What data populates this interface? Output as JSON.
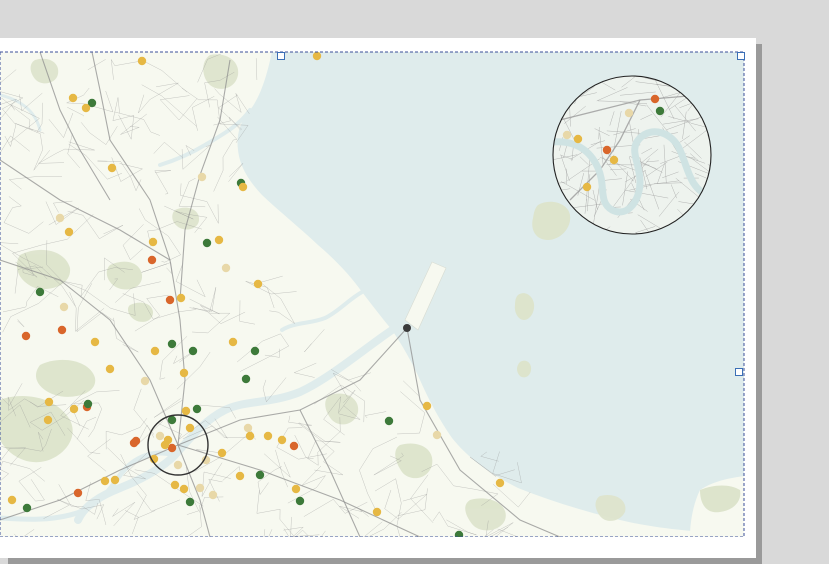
{
  "colors": {
    "background": "#d9d9d9",
    "page": "#ffffff",
    "land": "#f7f9f0",
    "water": "#dfecec",
    "parks": "#dde4cc",
    "roads": "#8f8f8f",
    "selection": "#3b6fb6",
    "marker_yellow": "#e6b844",
    "marker_orange": "#d9662b",
    "marker_green": "#3d7a3a",
    "marker_beige": "#e8d8a8",
    "marker_dark": "#3a3a3a"
  },
  "map": {
    "markers": [
      {
        "kind": "yellow"
      },
      {
        "kind": "yellow"
      },
      {
        "kind": "yellow"
      },
      {
        "kind": "green"
      },
      {
        "kind": "yellow"
      },
      {
        "kind": "yellow"
      },
      {
        "kind": "beige"
      },
      {
        "kind": "green"
      },
      {
        "kind": "yellow"
      },
      {
        "kind": "beige"
      },
      {
        "kind": "yellow"
      },
      {
        "kind": "yellow"
      },
      {
        "kind": "green"
      },
      {
        "kind": "yellow"
      },
      {
        "kind": "orange"
      },
      {
        "kind": "beige"
      },
      {
        "kind": "yellow"
      },
      {
        "kind": "green"
      },
      {
        "kind": "beige"
      },
      {
        "kind": "orange"
      },
      {
        "kind": "yellow"
      },
      {
        "kind": "orange"
      },
      {
        "kind": "yellow"
      },
      {
        "kind": "yellow"
      },
      {
        "kind": "green"
      },
      {
        "kind": "green"
      },
      {
        "kind": "yellow"
      },
      {
        "kind": "green"
      },
      {
        "kind": "yellow"
      },
      {
        "kind": "yellow"
      },
      {
        "kind": "beige"
      },
      {
        "kind": "green"
      },
      {
        "kind": "yellow"
      },
      {
        "kind": "yellow"
      },
      {
        "kind": "orange"
      },
      {
        "kind": "yellow"
      },
      {
        "kind": "green"
      },
      {
        "kind": "green"
      },
      {
        "kind": "yellow"
      },
      {
        "kind": "beige"
      },
      {
        "kind": "yellow"
      },
      {
        "kind": "yellow"
      },
      {
        "kind": "orange"
      },
      {
        "kind": "dark"
      },
      {
        "kind": "yellow"
      },
      {
        "kind": "beige"
      },
      {
        "kind": "yellow"
      },
      {
        "kind": "green"
      },
      {
        "kind": "yellow"
      },
      {
        "kind": "green"
      },
      {
        "kind": "yellow"
      },
      {
        "kind": "orange"
      },
      {
        "kind": "yellow"
      },
      {
        "kind": "yellow"
      },
      {
        "kind": "beige"
      },
      {
        "kind": "green"
      },
      {
        "kind": "yellow"
      },
      {
        "kind": "orange"
      },
      {
        "kind": "yellow"
      },
      {
        "kind": "beige"
      },
      {
        "kind": "yellow"
      },
      {
        "kind": "green"
      },
      {
        "kind": "yellow"
      },
      {
        "kind": "green"
      },
      {
        "kind": "yellow"
      },
      {
        "kind": "beige"
      },
      {
        "kind": "yellow"
      },
      {
        "kind": "orange"
      },
      {
        "kind": "yellow"
      },
      {
        "kind": "beige"
      },
      {
        "kind": "yellow"
      },
      {
        "kind": "green"
      },
      {
        "kind": "orange"
      },
      {
        "kind": "yellow"
      },
      {
        "kind": "green"
      },
      {
        "kind": "beige"
      },
      {
        "kind": "yellow"
      },
      {
        "kind": "orange"
      }
    ],
    "inset_markers": [
      {
        "kind": "orange"
      },
      {
        "kind": "green"
      },
      {
        "kind": "beige"
      },
      {
        "kind": "beige"
      },
      {
        "kind": "yellow"
      },
      {
        "kind": "orange"
      },
      {
        "kind": "yellow"
      },
      {
        "kind": "yellow"
      }
    ]
  }
}
